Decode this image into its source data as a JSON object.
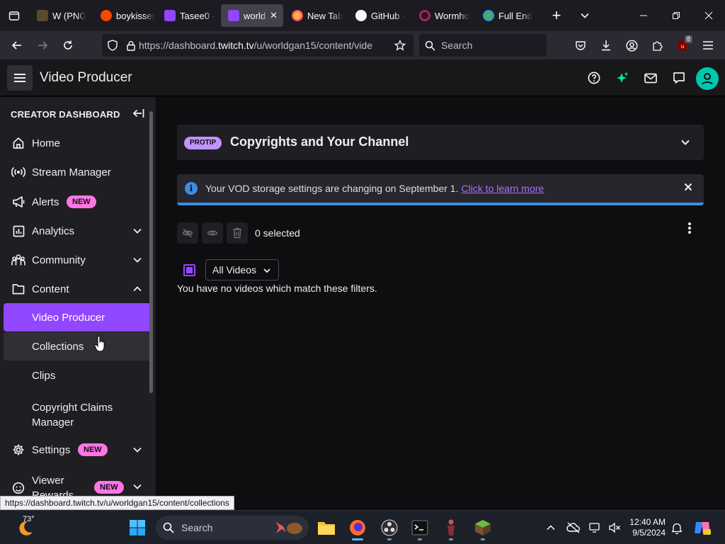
{
  "browser": {
    "tabs": [
      {
        "label": "W (PNG"
      },
      {
        "label": "boykisser"
      },
      {
        "label": "Tasee0 -"
      },
      {
        "label": "world"
      },
      {
        "label": "New Tab"
      },
      {
        "label": "GitHub -"
      },
      {
        "label": "Wormho"
      },
      {
        "label": "Full End"
      }
    ],
    "url_prefix": "https://dashboard.",
    "url_host": "twitch.tv",
    "url_path": "/u/worldgan15/content/vide",
    "search_placeholder": "Search",
    "extension_badge": "8"
  },
  "app": {
    "title": "Video Producer"
  },
  "sidebar": {
    "heading": "CREATOR DASHBOARD",
    "items": [
      {
        "label": "Home"
      },
      {
        "label": "Stream Manager"
      },
      {
        "label": "Alerts",
        "badge": "NEW"
      },
      {
        "label": "Analytics"
      },
      {
        "label": "Community"
      },
      {
        "label": "Content"
      }
    ],
    "content_sub": [
      {
        "label": "Video Producer"
      },
      {
        "label": "Collections"
      },
      {
        "label": "Clips"
      },
      {
        "label": "Copyright Claims",
        "label2": "Manager"
      }
    ],
    "settings": {
      "label": "Settings",
      "badge": "NEW"
    },
    "viewer_rewards": {
      "label": "Viewer",
      "label2": "Rewards",
      "badge": "NEW"
    }
  },
  "main": {
    "protip_badge": "PROTIP",
    "protip_title": "Copyrights and Your Channel",
    "notice_text": "Your VOD storage settings are changing on September 1.",
    "notice_link": "Click to learn more",
    "selected_count": "0 selected",
    "filter_value": "All Videos",
    "empty_message": "You have no videos which match these filters."
  },
  "statusbar": {
    "url": "https://dashboard.twitch.tv/u/worldgan15/content/collections"
  },
  "taskbar": {
    "weather": "73°",
    "search_placeholder": "Search",
    "time": "12:40 AM",
    "date": "9/5/2024"
  },
  "colors": {
    "twitch_purple": "#9147ff",
    "new_badge": "#ff75e6",
    "info_blue": "#3a8ee6"
  }
}
